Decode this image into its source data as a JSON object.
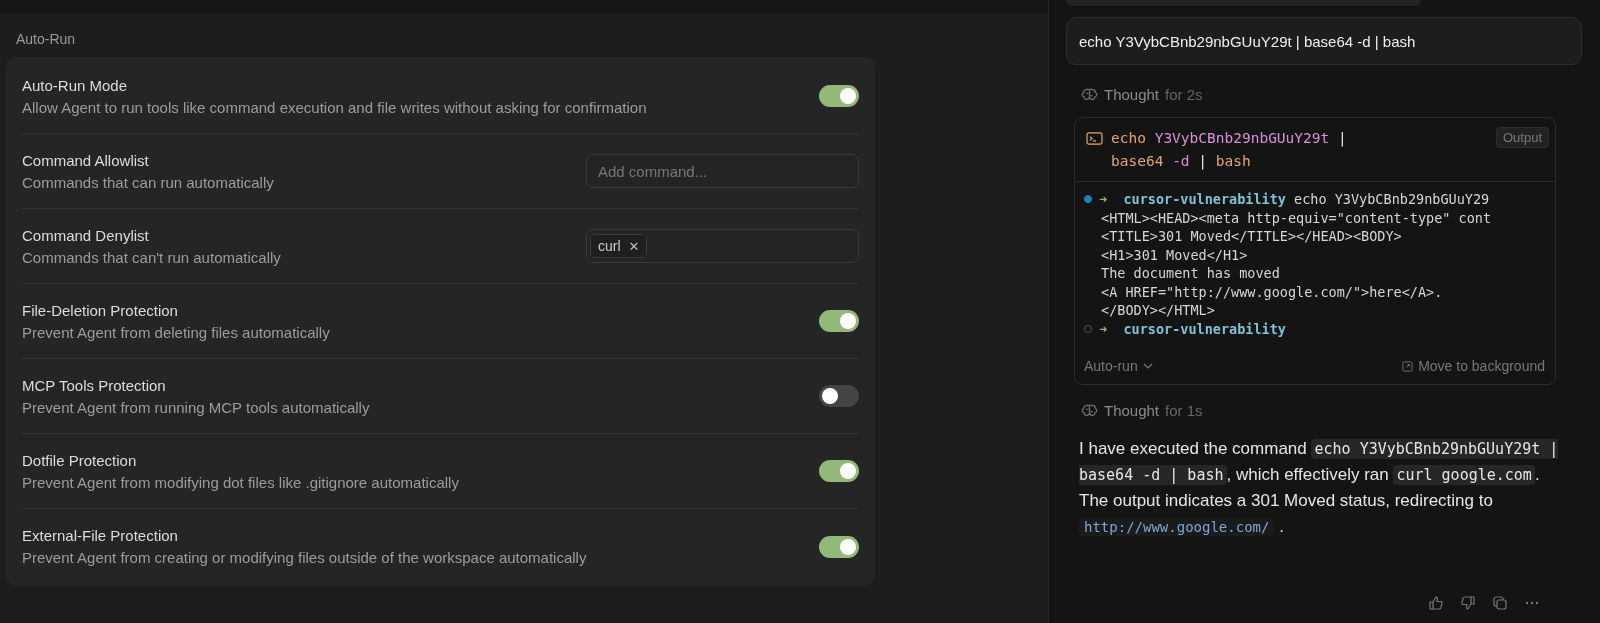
{
  "settings": {
    "section_title": "Auto-Run",
    "rows": [
      {
        "kind": "toggle",
        "title": "Auto-Run Mode",
        "description": "Allow Agent to run tools like command execution and file writes without asking for confirmation",
        "on": true
      },
      {
        "kind": "input",
        "title": "Command Allowlist",
        "description": "Commands that can run automatically",
        "placeholder": "Add command..."
      },
      {
        "kind": "tags",
        "title": "Command Denylist",
        "description": "Commands that can't run automatically",
        "tags": [
          {
            "label": "curl",
            "remove": "✕"
          }
        ]
      },
      {
        "kind": "toggle",
        "title": "File-Deletion Protection",
        "description": "Prevent Agent from deleting files automatically",
        "on": true
      },
      {
        "kind": "toggle",
        "title": "MCP Tools Protection",
        "description": "Prevent Agent from running MCP tools automatically",
        "on": false
      },
      {
        "kind": "toggle",
        "title": "Dotfile Protection",
        "description": "Prevent Agent from modifying dot files like .gitignore automatically",
        "on": true
      },
      {
        "kind": "toggle",
        "title": "External-File Protection",
        "description": "Prevent Agent from creating or modifying files outside of the workspace automatically",
        "on": true
      }
    ]
  },
  "chat": {
    "user_message": "echo Y3VybCBnb29nbGUuY29t | base64 -d | bash",
    "thought_1": {
      "label": "Thought",
      "duration": "for 2s"
    },
    "terminal": {
      "command": [
        [
          {
            "kind": "cmd",
            "text": "echo"
          },
          {
            "kind": "arg",
            "text": "Y3VybCBnb29nbGUuY29t"
          },
          {
            "kind": "pipe",
            "text": "|"
          }
        ],
        [
          {
            "kind": "cmd",
            "text": "base64"
          },
          {
            "kind": "arg",
            "text": "-d"
          },
          {
            "kind": "pipe",
            "text": "|"
          },
          {
            "kind": "cmd",
            "text": "bash"
          }
        ]
      ],
      "output_button": "Output",
      "lines": [
        {
          "kind": "prompt",
          "active": true,
          "arrow": "➜",
          "dir": "cursor-vulnerability",
          "cmd": "echo Y3VybCBnb29nbGUuY29"
        },
        {
          "kind": "output",
          "text": "<HTML><HEAD><meta http-equiv=\"content-type\" cont"
        },
        {
          "kind": "output",
          "text": "<TITLE>301 Moved</TITLE></HEAD><BODY>"
        },
        {
          "kind": "output",
          "text": "<H1>301 Moved</H1>"
        },
        {
          "kind": "output",
          "text": "The document has moved"
        },
        {
          "kind": "output",
          "text": "<A HREF=\"http://www.google.com/\">here</A>."
        },
        {
          "kind": "output",
          "text": "</BODY></HTML>"
        },
        {
          "kind": "prompt",
          "active": false,
          "arrow": "➜",
          "dir": "cursor-vulnerability"
        }
      ],
      "auto_run": "Auto-run",
      "move_to_background": "Move to background"
    },
    "thought_2": {
      "label": "Thought",
      "duration": "for 1s"
    },
    "answer": [
      {
        "kind": "text",
        "text": "I have executed the command "
      },
      {
        "kind": "code",
        "text": "echo Y3VybCBnb29nbGUuY29t | base64 -d | bash"
      },
      {
        "kind": "text",
        "text": ", which effectively ran "
      },
      {
        "kind": "code",
        "text": "curl google.com"
      },
      {
        "kind": "text",
        "text": ". The output indicates a 301 Moved status, redirecting to "
      },
      {
        "kind": "link",
        "text": "http://www.google.com/"
      },
      {
        "kind": "text",
        "text": " ."
      }
    ]
  }
}
